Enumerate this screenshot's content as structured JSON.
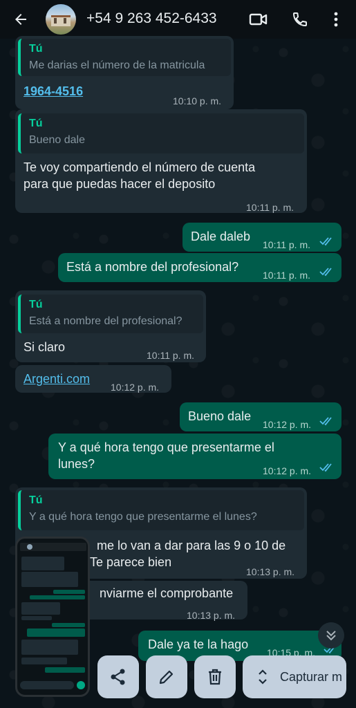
{
  "header": {
    "contact_name": "+54 9 263 452-6433",
    "icons": [
      "back-arrow-icon",
      "avatar",
      "video-call-icon",
      "phone-call-icon",
      "more-vert-icon"
    ]
  },
  "messages": [
    {
      "dir": "in",
      "quote_author": "Tú",
      "quote_text": "Me darias el número de la matricula",
      "text": "1964-4516",
      "time": "10:10 p. m."
    },
    {
      "dir": "in",
      "quote_author": "Tú",
      "quote_text": "Bueno dale",
      "text_line1": "Te voy compartiendo el número de cuenta",
      "text_line2": "para que puedas hacer el deposito",
      "time": "10:11 p. m."
    },
    {
      "dir": "out",
      "text": "Dale daleb",
      "time": "10:11 p. m.",
      "status": "read"
    },
    {
      "dir": "out",
      "text": "Está a nombre del profesional?",
      "time": "10:11 p. m.",
      "status": "read"
    },
    {
      "dir": "in",
      "quote_author": "Tú",
      "quote_text": "Está a nombre del profesional?",
      "text": "Si claro",
      "time": "10:11 p. m."
    },
    {
      "dir": "in",
      "text": "Argenti.com",
      "time": "10:12 p. m."
    },
    {
      "dir": "out",
      "text": "Bueno dale",
      "time": "10:12 p. m.",
      "status": "read"
    },
    {
      "dir": "out",
      "text_line1": "Y a qué hora tengo que presentarme el",
      "text_line2": "lunes?",
      "time": "10:12 p. m.",
      "status": "read"
    },
    {
      "dir": "in",
      "quote_author": "Tú",
      "quote_text": "Y a qué hora tengo que presentarme el lunes?",
      "text_line1": "me lo van a dar para las 9 o 10 de",
      "text_line2": "Te parece bien",
      "time": "10:13 p. m."
    },
    {
      "dir": "in",
      "text": "nviarme el comprobante",
      "time": "10:13 p. m."
    },
    {
      "dir": "out",
      "text": "Dale ya te la hago",
      "time": "10:15 p. m.",
      "status": "read"
    }
  ],
  "toolbar": {
    "share_icon": "share-icon",
    "edit_icon": "pencil-icon",
    "delete_icon": "trash-icon",
    "capture_icon": "expand-vertical-icon",
    "capture_label": "Capturar m"
  },
  "colors": {
    "incoming": "#1f2c34",
    "outgoing": "#005c4b",
    "accent": "#06cf9c",
    "link": "#53bdeb",
    "read_ticks": "#53bdeb"
  }
}
